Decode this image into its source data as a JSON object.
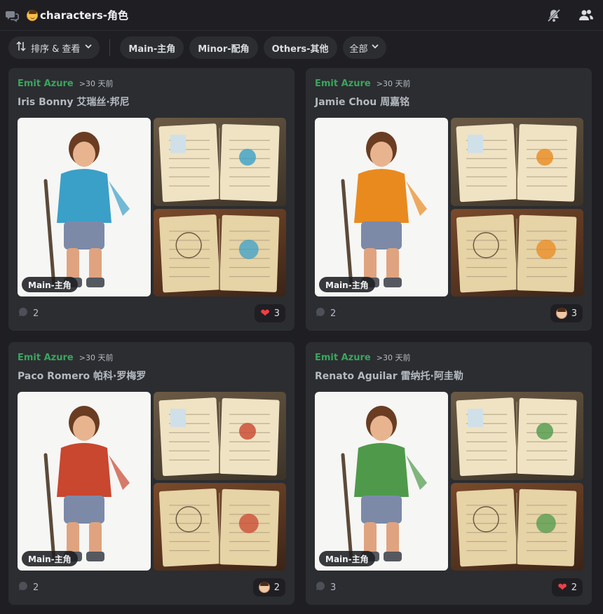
{
  "channel": {
    "name": "characters-角色"
  },
  "filters": {
    "sort_label": "排序 & 查看",
    "tags": [
      "Main-主角",
      "Minor-配角",
      "Others-其他"
    ],
    "all_label": "全部"
  },
  "posts": [
    {
      "author": "Emit Azure",
      "time": ">30 天前",
      "title": "Iris Bonny 艾瑞丝·邦尼",
      "tag": "Main-主角",
      "comments": "2",
      "reaction_icon": "heart-icon",
      "reactions": "3",
      "accent": "#3aa0c8"
    },
    {
      "author": "Emit Azure",
      "time": ">30 天前",
      "title": "Jamie Chou 周嘉铭",
      "tag": "Main-主角",
      "comments": "2",
      "reaction_icon": "face-icon",
      "reactions": "3",
      "accent": "#e98a1f"
    },
    {
      "author": "Emit Azure",
      "time": ">30 天前",
      "title": "Paco Romero 帕科·罗梅罗",
      "tag": "Main-主角",
      "comments": "2",
      "reaction_icon": "face-icon",
      "reactions": "2",
      "accent": "#c9462f"
    },
    {
      "author": "Emit Azure",
      "time": ">30 天前",
      "title": "Renato Aguilar 雷纳托·阿圭勒",
      "tag": "Main-主角",
      "comments": "3",
      "reaction_icon": "heart-icon",
      "reactions": "2",
      "accent": "#4f9a4a"
    }
  ],
  "colors": {
    "author": "#3ba55d",
    "background": "#1f1f23",
    "card": "#2b2d31",
    "heart": "#f23f43"
  }
}
